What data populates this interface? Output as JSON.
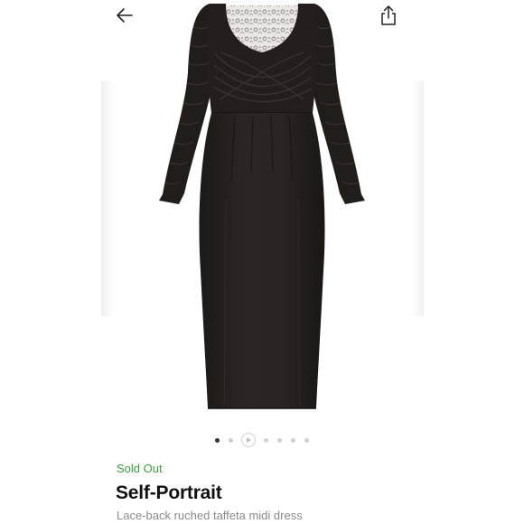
{
  "header": {
    "back_icon": "arrow-left-icon",
    "share_icon": "share-icon"
  },
  "gallery": {
    "image_description_icon": "dress-photo",
    "current_index": 1,
    "total_items": 7,
    "video_item_index": 3
  },
  "product": {
    "status": "Sold Out",
    "brand": "Self-Portrait",
    "name": "Lace-back ruched taffeta midi dress"
  },
  "colors": {
    "status_green": "#3a9a3e",
    "dress_black": "#231f1d",
    "text_dark": "#111111",
    "text_muted": "#8a8a8a"
  }
}
